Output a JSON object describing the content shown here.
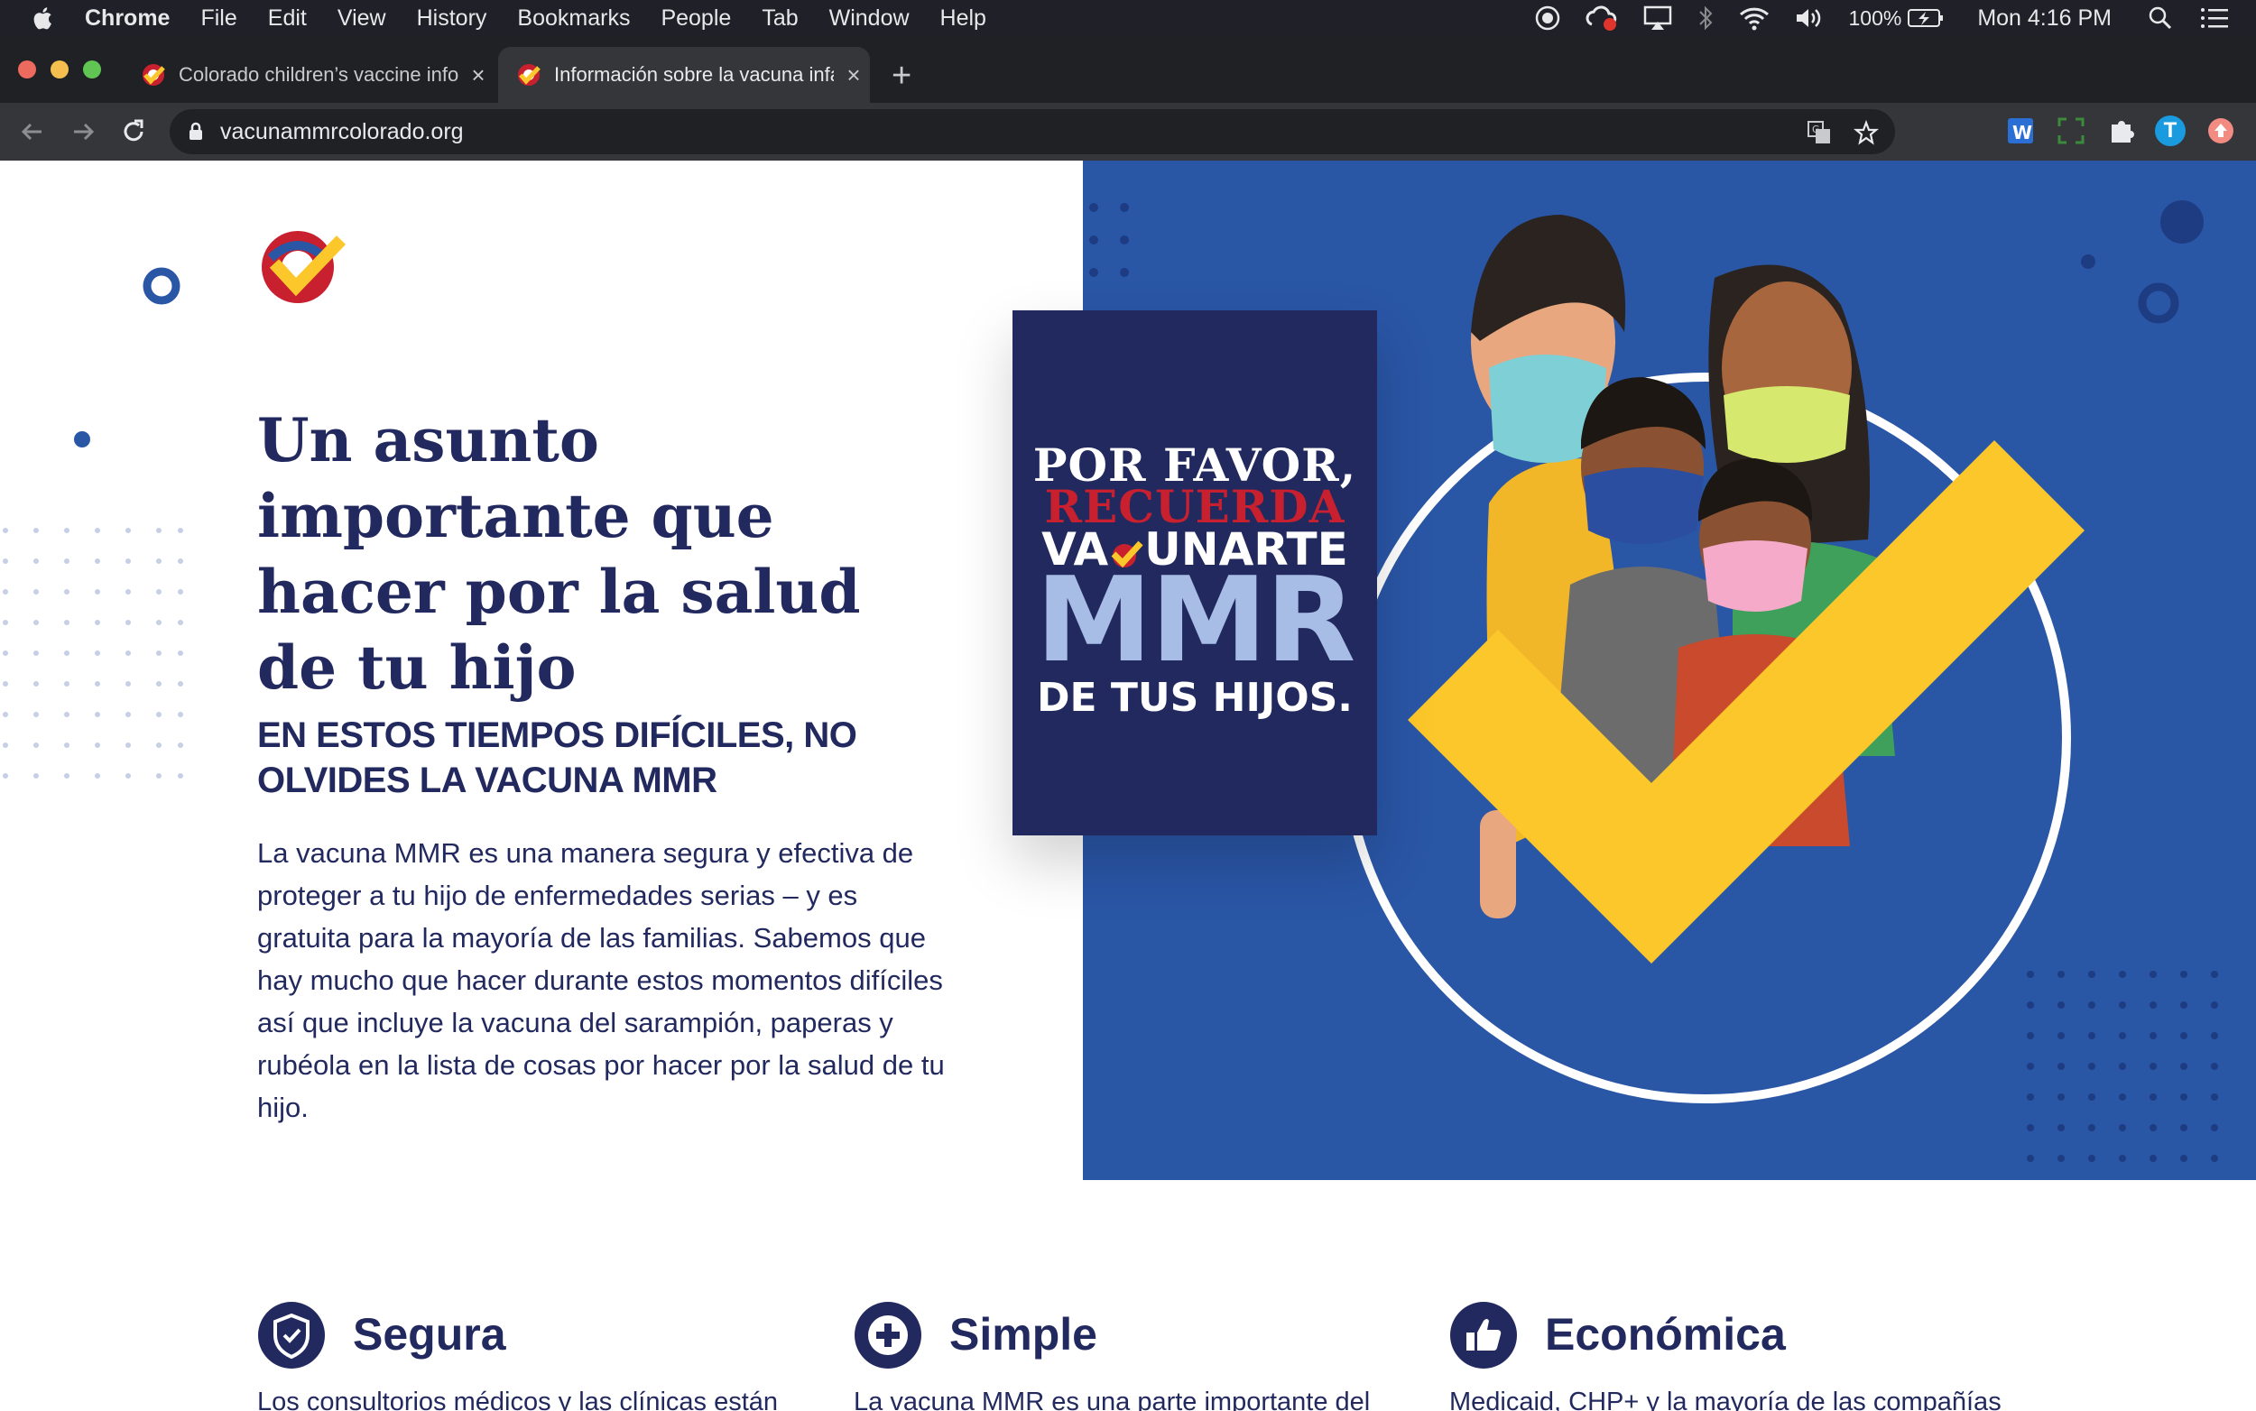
{
  "menubar": {
    "app": "Chrome",
    "items": [
      "File",
      "Edit",
      "View",
      "History",
      "Bookmarks",
      "People",
      "Tab",
      "Window",
      "Help"
    ],
    "battery": "100%",
    "clock": "Mon 4:16 PM"
  },
  "tabs": [
    {
      "title": "Colorado children’s vaccine info",
      "active": false
    },
    {
      "title": "Información sobre la vacuna infantil",
      "active": true
    }
  ],
  "address_bar": {
    "url": "vacunammrcolorado.org"
  },
  "extensions": {
    "profile_initial": "T"
  },
  "hero": {
    "title": "Un asunto importante que hacer por la salud de tu hijo",
    "subtitle": "EN ESTOS TIEMPOS DIFÍCILES, NO OLVIDES LA VACUNA MMR",
    "body": "La vacuna MMR es una manera segura y efectiva de proteger a tu hijo de enfermedades serias – y es gratuita para la mayoría de las familias. Sabemos que hay mucho que hacer durante estos momentos difíciles así que incluye la vacuna del sarampión, paperas y rubéola en la lista de cosas por hacer por la salud de tu hijo."
  },
  "poster": {
    "line1": "POR FAVOR,",
    "line2": "RECUERDA",
    "line3a": "VA",
    "line3b": "UNARTE",
    "line4": "MMR",
    "line5": "DE TUS HIJOS."
  },
  "features": [
    {
      "icon": "shield-check-icon",
      "title": "Segura",
      "text": "Los consultorios médicos y las clínicas están"
    },
    {
      "icon": "plus-circle-icon",
      "title": "Simple",
      "text": "La vacuna MMR es una parte importante del"
    },
    {
      "icon": "thumbs-up-icon",
      "title": "Económica",
      "text": "Medicaid, CHP+ y la mayoría de las compañías"
    }
  ],
  "colors": {
    "navy": "#22295f",
    "hero_blue": "#2a56a6",
    "accent_yellow": "#fcc72a",
    "accent_red": "#c8202f"
  }
}
